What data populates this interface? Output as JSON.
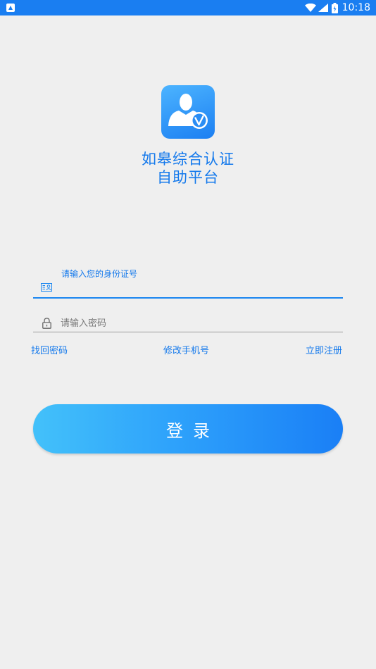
{
  "status_bar": {
    "time": "10:18",
    "icons": [
      "notification-icon",
      "wifi-icon",
      "signal-icon",
      "battery-icon"
    ],
    "background": "#1a7ef1"
  },
  "app": {
    "logo_icon": "user-verified-icon",
    "title_line1": "如皋综合认证",
    "title_line2": "自助平台",
    "accent_color": "#1479ec"
  },
  "form": {
    "id_field": {
      "label": "请输入您的身份证号",
      "value": "",
      "icon": "id-card-icon"
    },
    "password_field": {
      "placeholder": "请输入密码",
      "value": "",
      "icon": "lock-icon"
    }
  },
  "links": {
    "forgot_password": "找回密码",
    "change_phone": "修改手机号",
    "register": "立即注册"
  },
  "login_button": {
    "label": "登录"
  }
}
